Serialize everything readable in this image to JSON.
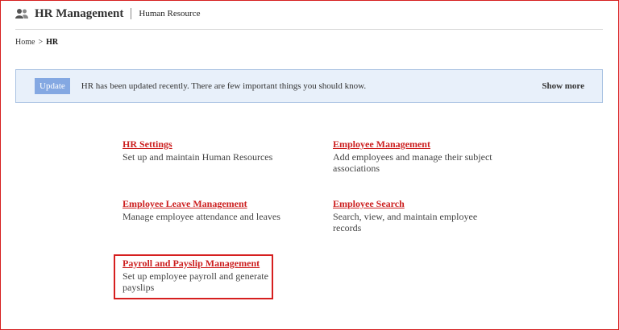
{
  "header": {
    "title": "HR Management",
    "subtitle": "Human Resource",
    "icon": "users-icon"
  },
  "breadcrumb": {
    "home": "Home",
    "separator": ">",
    "current": "HR"
  },
  "alert": {
    "badge": "Update",
    "message": "HR has been updated recently. There are few important things you should know.",
    "action": "Show more"
  },
  "modules": [
    {
      "title": "HR Settings",
      "description": "Set up and maintain Human Resources"
    },
    {
      "title": "Employee Management",
      "description": "Add employees and manage their subject associations"
    },
    {
      "title": "Employee Leave Management",
      "description": "Manage employee attendance and leaves"
    },
    {
      "title": "Employee Search",
      "description": "Search, view, and maintain employee records"
    },
    {
      "title": "Payroll and Payslip Management",
      "description": "Set up employee payroll and generate payslips"
    }
  ],
  "colors": {
    "accent_red": "#cc1f1f",
    "alert_bg": "#e8f0fa",
    "badge_bg": "#84a8e2"
  }
}
